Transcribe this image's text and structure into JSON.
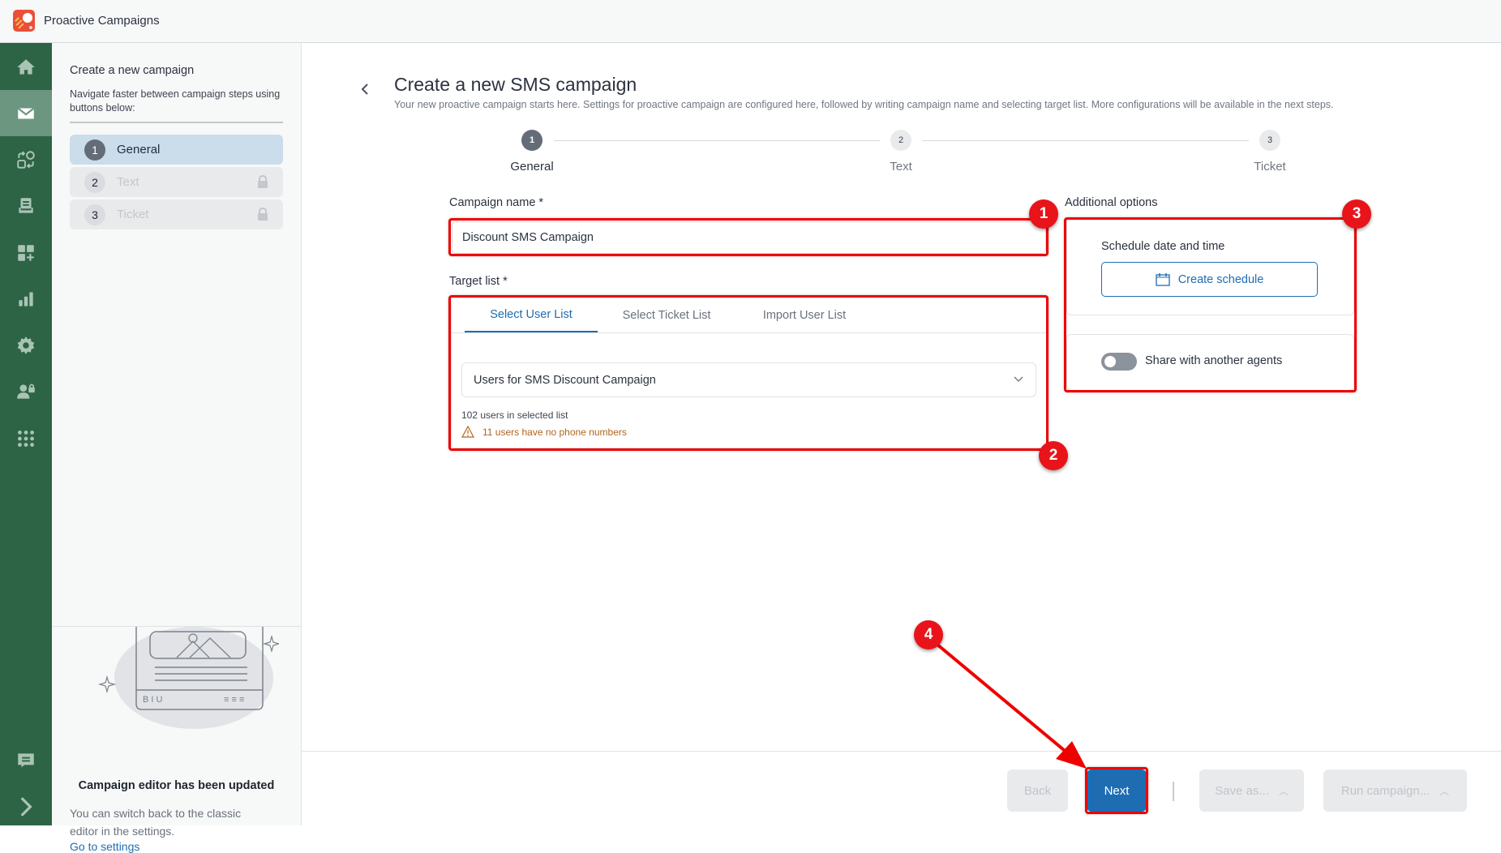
{
  "app": {
    "title": "Proactive Campaigns"
  },
  "rail": {
    "items": [
      {
        "icon": "home-icon",
        "label": "Home"
      },
      {
        "icon": "mail-icon",
        "label": "Campaigns",
        "active": true
      },
      {
        "icon": "workflow-icon",
        "label": "Flows"
      },
      {
        "icon": "knowledge-base-icon",
        "label": "Knowledge base"
      },
      {
        "icon": "add-widget-icon",
        "label": "Widgets"
      },
      {
        "icon": "bar-chart-icon",
        "label": "Reports"
      },
      {
        "icon": "gear-icon",
        "label": "Settings"
      },
      {
        "icon": "user-lock-icon",
        "label": "Permissions"
      },
      {
        "icon": "apps-grid-icon",
        "label": "Apps"
      }
    ],
    "bottom": [
      {
        "icon": "chat-icon",
        "label": "Feedback"
      },
      {
        "icon": "chevron-right-icon",
        "label": "Expand"
      }
    ]
  },
  "left_panel": {
    "title": "Create a new campaign",
    "description": "Navigate faster between campaign steps using buttons below:",
    "steps": [
      {
        "number": "1",
        "label": "General",
        "active": true,
        "locked": false
      },
      {
        "number": "2",
        "label": "Text",
        "active": false,
        "locked": true
      },
      {
        "number": "3",
        "label": "Ticket",
        "active": false,
        "locked": true
      }
    ],
    "update_notice": {
      "title": "Campaign editor has been updated",
      "description": "You can switch back to the classic editor in the settings.",
      "link": "Go to settings"
    }
  },
  "main": {
    "title": "Create a new SMS campaign",
    "subtitle": "Your new proactive campaign starts here. Settings for proactive campaign are configured here, followed by writing campaign name and selecting target list. More configurations will be available in the next steps.",
    "stepper": [
      {
        "number": "1",
        "label": "General",
        "active": true
      },
      {
        "number": "2",
        "label": "Text",
        "active": false
      },
      {
        "number": "3",
        "label": "Ticket",
        "active": false
      }
    ],
    "campaign_name": {
      "label": "Campaign name *",
      "value": "Discount SMS Campaign"
    },
    "target_list": {
      "label": "Target list *",
      "tabs": [
        {
          "label": "Select User List",
          "active": true
        },
        {
          "label": "Select Ticket List",
          "active": false
        },
        {
          "label": "Import User List",
          "active": false
        }
      ],
      "selected": "Users for SMS Discount Campaign",
      "count_text": "102 users in selected list",
      "warning_text": "11 users have no phone numbers"
    },
    "additional_options": {
      "label": "Additional options",
      "schedule_label": "Schedule date and time",
      "schedule_button": "Create schedule",
      "share_label": "Share with another agents",
      "share_enabled": false
    }
  },
  "footer": {
    "back": "Back",
    "next": "Next",
    "save_as": "Save as...",
    "run_campaign": "Run campaign..."
  },
  "annotations": {
    "markers": [
      "1",
      "2",
      "3",
      "4"
    ]
  },
  "colors": {
    "rail": "#2d6446",
    "accent": "#1e6db3",
    "warning": "#b2641b",
    "annotation": "#ee0000"
  }
}
